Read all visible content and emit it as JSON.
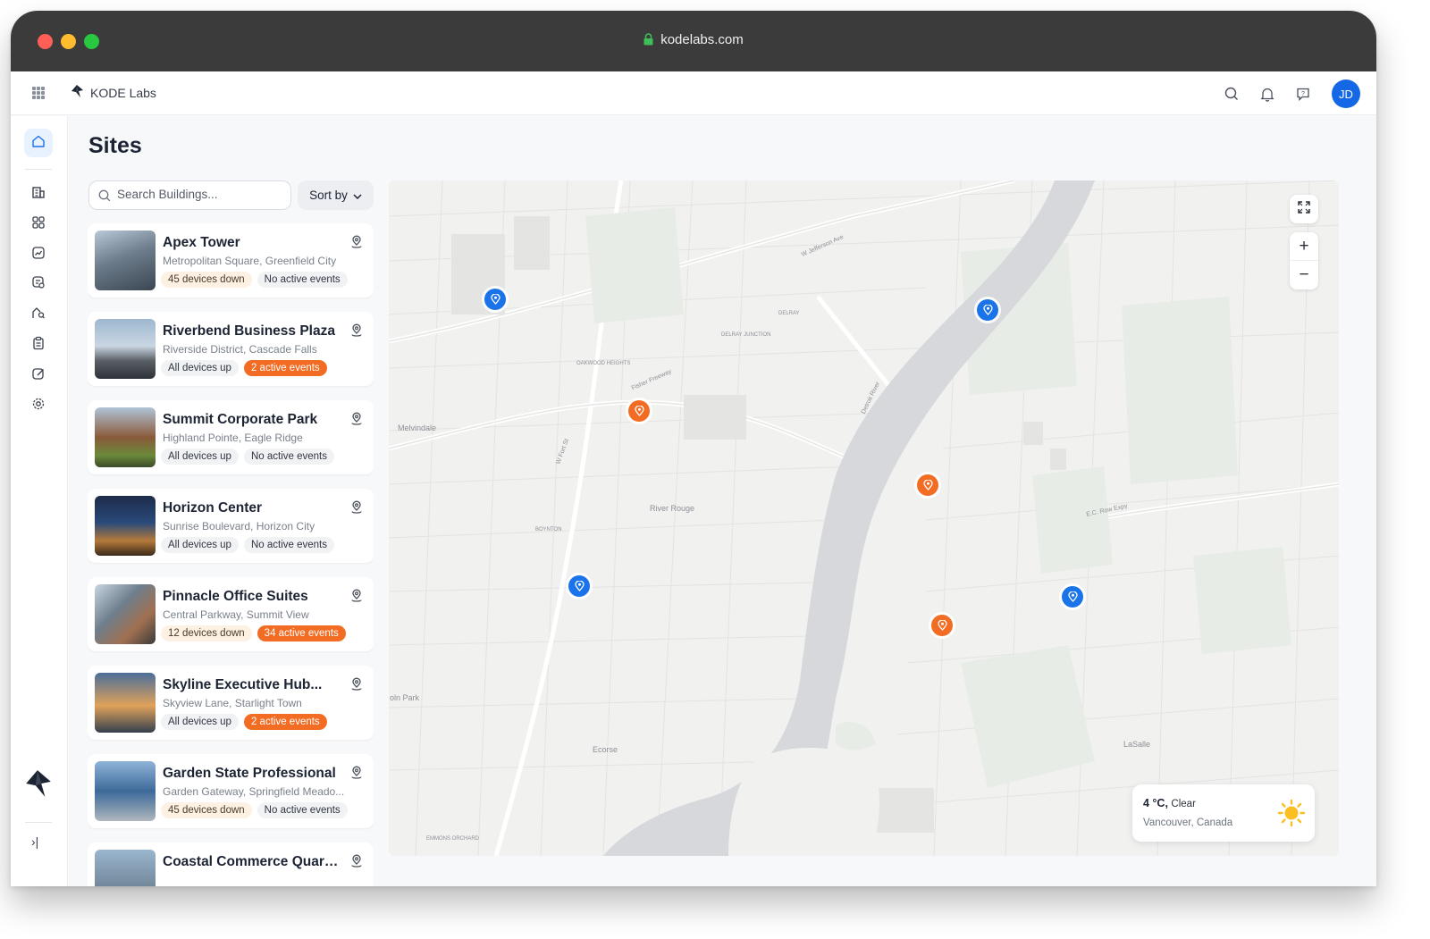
{
  "browser": {
    "url": "kodelabs.com"
  },
  "header": {
    "brand": "KODE Labs",
    "avatar_initials": "JD",
    "icons": [
      "apps-grid-icon",
      "search-icon",
      "bell-icon",
      "help-icon"
    ]
  },
  "sidebar": {
    "items": [
      "home",
      "buildings",
      "dashboards",
      "analytics",
      "work-orders",
      "reports",
      "checklists",
      "notes",
      "settings"
    ],
    "collapse_label": "›|"
  },
  "page": {
    "title": "Sites"
  },
  "search": {
    "placeholder": "Search Buildings..."
  },
  "sort": {
    "label": "Sort by"
  },
  "sites": [
    {
      "name": "Apex Tower",
      "address": "Metropolitan Square, Greenfield City",
      "devices": "45 devices down",
      "devices_status": "warn",
      "events": "No active events",
      "events_status": "ok"
    },
    {
      "name": "Riverbend Business Plaza",
      "address": "Riverside District, Cascade Falls",
      "devices": "All devices up",
      "devices_status": "ok",
      "events": "2 active events",
      "events_status": "alert"
    },
    {
      "name": "Summit Corporate Park",
      "address": "Highland Pointe, Eagle Ridge",
      "devices": "All devices up",
      "devices_status": "ok",
      "events": "No active events",
      "events_status": "ok"
    },
    {
      "name": "Horizon Center",
      "address": "Sunrise Boulevard, Horizon City",
      "devices": "All devices up",
      "devices_status": "ok",
      "events": "No active events",
      "events_status": "ok"
    },
    {
      "name": "Pinnacle Office Suites",
      "address": "Central Parkway, Summit View",
      "devices": "12 devices down",
      "devices_status": "warn",
      "events": "34 active events",
      "events_status": "alert"
    },
    {
      "name": "Skyline Executive Hub...",
      "address": "Skyview Lane, Starlight Town",
      "devices": "All devices up",
      "devices_status": "ok",
      "events": "2 active events",
      "events_status": "alert"
    },
    {
      "name": "Garden State Professional",
      "address": "Garden Gateway, Springfield Meado...",
      "devices": "45 devices down",
      "devices_status": "warn",
      "events": "No active events",
      "events_status": "ok"
    },
    {
      "name": "Coastal Commerce Quarters",
      "address": "",
      "devices": "",
      "devices_status": "ok",
      "events": "",
      "events_status": "ok"
    }
  ],
  "map": {
    "place_labels": [
      "Melvindale",
      "River Rouge",
      "Ecorse",
      "LaSalle",
      "oln Park",
      "DELRAY",
      "DELRAY JUNCTION",
      "OAKWOOD HEIGHTS",
      "BOYNTON",
      "EMMONS ORCHARD"
    ],
    "road_labels": [
      "Fisher Freeway",
      "W Jefferson Ave",
      "Detroit River",
      "E.C. Row Expy",
      "W Fort St"
    ],
    "markers": [
      {
        "color": "#1a73e8",
        "kind": "site"
      },
      {
        "color": "#1a73e8",
        "kind": "site"
      },
      {
        "color": "#f26c24",
        "kind": "alert"
      },
      {
        "color": "#f26c24",
        "kind": "alert"
      },
      {
        "color": "#1a73e8",
        "kind": "site"
      },
      {
        "color": "#1a73e8",
        "kind": "site"
      },
      {
        "color": "#f26c24",
        "kind": "alert"
      }
    ],
    "controls": {
      "zoom_in": "+",
      "zoom_out": "−"
    }
  },
  "weather": {
    "temp": "4 °C,",
    "condition": "Clear",
    "location": "Vancouver, Canada"
  },
  "colors": {
    "accent": "#1468e6",
    "alert": "#f26c24",
    "warn_bg": "#fdf1e4"
  }
}
